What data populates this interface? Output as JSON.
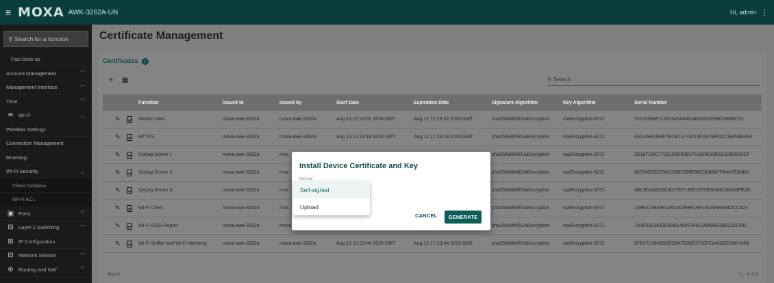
{
  "header": {
    "brand": "MOXA",
    "model": "AWK-3262A-UN",
    "greeting": "Hi, admin"
  },
  "sidebar": {
    "search_placeholder": "Search for a function",
    "items": [
      {
        "label": "Fast Boot-up",
        "level": "sub"
      },
      {
        "label": "Account Management",
        "level": "group",
        "chevron": "down"
      },
      {
        "label": "Management Interface",
        "level": "group",
        "chevron": "down"
      },
      {
        "label": "Time",
        "level": "group",
        "chevron": "down"
      },
      {
        "label": "Wi-Fi",
        "level": "top",
        "icon": "wifi-icon",
        "chevron": "up"
      },
      {
        "label": "Wireless Settings",
        "level": "group"
      },
      {
        "label": "Connection Management",
        "level": "group"
      },
      {
        "label": "Roaming",
        "level": "group"
      },
      {
        "label": "Wi-Fi Security",
        "level": "group",
        "chevron": "up"
      },
      {
        "label": "Client Isolation",
        "level": "sub2"
      },
      {
        "label": "Wi-Fi ACL",
        "level": "sub2"
      },
      {
        "label": "Ports",
        "level": "top",
        "icon": "ports-icon",
        "chevron": "down"
      },
      {
        "label": "Layer 2 Switching",
        "level": "top",
        "icon": "switch-icon",
        "chevron": "down"
      },
      {
        "label": "IP Configuration",
        "level": "top",
        "icon": "ip-config-icon"
      },
      {
        "label": "Network Service",
        "level": "top",
        "icon": "network-icon",
        "chevron": "down"
      },
      {
        "label": "Routing and NAT",
        "level": "top",
        "icon": "routing-icon",
        "chevron": "down"
      }
    ]
  },
  "page": {
    "title": "Certificate Management",
    "section": "Certificates",
    "search_placeholder": "Search"
  },
  "table": {
    "columns": [
      "Function",
      "Issued to",
      "Issued by",
      "Start Date",
      "Expiration Date",
      "Signature Algorithm",
      "Key Algorithm",
      "Serial Number"
    ],
    "rows": [
      {
        "function": "Device Data",
        "issued_to": "moxa-awk-3262a",
        "issued_by": "moxa-awk-3262a",
        "start": "Aug 13 17:23:32 2024 GMT",
        "expiration": "Aug 12 17:23:32 2029 GMT",
        "sig": "sha256WithRSAEncryption",
        "key": "rsaEncryption-3072",
        "serial": "22161084F11291545AB4034FAB04539018666C31"
      },
      {
        "function": "HTTPS",
        "issued_to": "moxa-awk-3262a",
        "issued_by": "moxa-awk-3262a",
        "start": "Aug 13 17:23:18 2024 GMT",
        "expiration": "Aug 12 17:23:18 2029 GMT",
        "sig": "sha256WithRSAEncryption",
        "key": "rsaEncryption-3072",
        "serial": "49C4A843E8F7B76C1F74213FDA7BFDCCEB58B3EA"
      },
      {
        "function": "Syslog Server 1",
        "issued_to": "moxa-awk-3262a",
        "issued_by": "mox",
        "start": "",
        "expiration": "",
        "sig": "sha256WithRSAEncryption",
        "key": "rsaEncryption-3072",
        "serial": "3E187CDC7733196E60B37CAD0619E6C62B3910CF"
      },
      {
        "function": "Syslog Server 2",
        "issued_to": "moxa-awk-3262a",
        "issued_by": "mox",
        "start": "",
        "expiration": "",
        "sig": "sha256WithRSAEncryption",
        "key": "rsaEncryption-3072",
        "serial": "067043E9237641DDD3B5FB6C5680A7F6447ED4D0"
      },
      {
        "function": "Syslog Server 3",
        "issued_to": "moxa-awk-3262a",
        "issued_by": "mox",
        "start": "",
        "expiration": "",
        "sig": "sha256WithRSAEncryption",
        "key": "rsaEncryption-3072",
        "serial": "4BC8DA4D18C4D7597169C097592D84C06A08FE2D"
      },
      {
        "function": "Wi-Fi Client",
        "issued_to": "moxa-awk-3262a",
        "issued_by": "mox",
        "start": "",
        "expiration": "",
        "sig": "sha256WithRSAEncryption",
        "key": "rsaEncryption-3072",
        "serial": "156EA738499143016DFEE1EF191395B084DCC423"
      },
      {
        "function": "Wi-Fi RSSI Report",
        "issued_to": "moxa-awk-3262a",
        "issued_by": "moxa-awk-3262a",
        "start": "Aug 13 17:23:27 2024 GMT",
        "expiration": "Aug 12 17:23:27 2029 GMT",
        "sig": "sha256WithRSAEncryption",
        "key": "rsaEncryption-3072",
        "serial": "7A4F2321653E6AB1450F34AC086BB03B5221F08C"
      },
      {
        "function": "Wi-Fi Sniffer and Wi-Fi Mirroring",
        "issued_to": "moxa-awk-3262a",
        "issued_by": "moxa-awk-3262a",
        "start": "Aug 13 17:23:44 2024 GMT",
        "expiration": "Aug 12 17:23:44 2029 GMT",
        "sig": "sha256WithRSAEncryption",
        "key": "rsaEncryption-3072",
        "serial": "5FE471364EB5ED2A7E00E3720FCA40922D867A4B"
      }
    ],
    "footer_left": "Max 8",
    "footer_right": "1 – 8 of 8"
  },
  "dialog": {
    "title": "Install Device Certificate and Key",
    "field_label": "Method *",
    "options": [
      "Self-signed",
      "Upload"
    ],
    "selected": "Self-signed",
    "cancel_label": "CANCEL",
    "generate_label": "GENERATE"
  },
  "colors": {
    "brand_dark": "#0a3e3c",
    "accent": "#0d5e59"
  }
}
